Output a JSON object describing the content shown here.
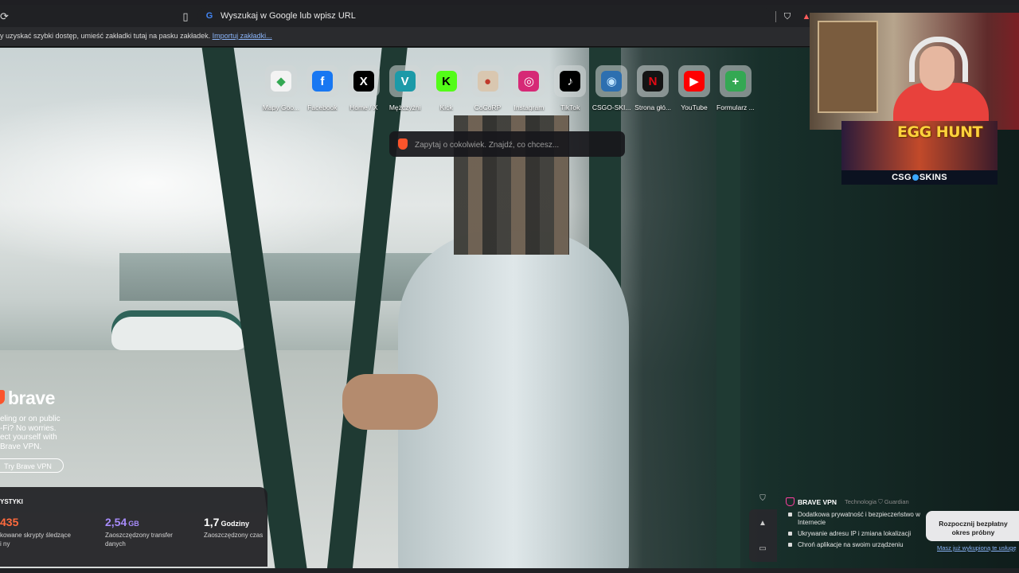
{
  "toolbar": {
    "url_placeholder": "Wyszukaj w Google lub wpisz URL"
  },
  "bookmarks_bar": {
    "message": "y uzyskać szybki dostęp, umieść zakładki tutaj na pasku zakładek.",
    "import_link": "Importuj zakładki..."
  },
  "shortcuts": [
    {
      "label": "Mapy Goo...",
      "icon": "maps-icon",
      "glyph": "◆",
      "bg": "#f3f3f3",
      "color": "#34a853"
    },
    {
      "label": "Facebook",
      "icon": "facebook-icon",
      "glyph": "f",
      "bg": "#1877f2",
      "color": "#ffffff"
    },
    {
      "label": "Home / X",
      "icon": "x-icon",
      "glyph": "X",
      "bg": "#000000",
      "color": "#ffffff"
    },
    {
      "label": "Mężczyźni",
      "icon": "v-icon",
      "glyph": "V",
      "bg": "#1c9aa8",
      "color": "#ffffff"
    },
    {
      "label": "Kick",
      "icon": "kick-icon",
      "glyph": "K",
      "bg": "#53fc18",
      "color": "#000000"
    },
    {
      "label": "CoCoRP",
      "icon": "cocorp-icon",
      "glyph": "●",
      "bg": "#d9c7b0",
      "color": "#c0392b"
    },
    {
      "label": "Instagram",
      "icon": "instagram-icon",
      "glyph": "◎",
      "bg": "#d62976",
      "color": "#ffffff"
    },
    {
      "label": "TikTok",
      "icon": "tiktok-icon",
      "glyph": "♪",
      "bg": "#000000",
      "color": "#ffffff"
    },
    {
      "label": "CSGO-SKI...",
      "icon": "csgoskins-icon",
      "glyph": "◉",
      "bg": "#2d6fb0",
      "color": "#bfe4ff"
    },
    {
      "label": "Strona głó...",
      "icon": "netflix-icon",
      "glyph": "N",
      "bg": "#141414",
      "color": "#e50914"
    },
    {
      "label": "YouTube",
      "icon": "youtube-icon",
      "glyph": "▶",
      "bg": "#ff0000",
      "color": "#ffffff"
    },
    {
      "label": "Formularz ...",
      "icon": "plus-icon",
      "glyph": "+",
      "bg": "#34a853",
      "color": "#ffffff"
    }
  ],
  "search": {
    "placeholder": "Zapytaj o cokolwiek. Znajdź, co chcesz..."
  },
  "promo": {
    "logo_text": "brave",
    "lines": [
      "eling or on public",
      "-Fi? No worries.",
      "ect yourself with",
      "Brave VPN."
    ],
    "button": "Try Brave VPN"
  },
  "stats": {
    "title": "YSTYKI",
    "items": [
      {
        "value": "435",
        "unit": "",
        "caption": "kowane skrypty śledzące i ny",
        "color": "#ff6a3d"
      },
      {
        "value": "2,54",
        "unit": "GB",
        "caption": "Zaoszczędzony transfer danych",
        "color": "#a78bfa"
      },
      {
        "value": "1,7",
        "unit": "Godziny",
        "caption": "Zaoszczędzony czas",
        "color": "#ffffff"
      }
    ]
  },
  "vpn": {
    "title": "BRAVE VPN",
    "tech": "Technologia ⛉ Guardian",
    "features": [
      "Dodatkowa prywatność i bezpieczeństwo w Internecie",
      "Ukrywanie adresu IP i zmiana lokalizacji",
      "Chroń aplikacje na swoim urządzeniu"
    ],
    "cta": "Rozpocznij bezpłatny okres próbny",
    "already": "Masz już wykupioną te usługę"
  },
  "overlay": {
    "event_title": "EGG HUNT",
    "brand_left": "CSG",
    "brand_right": "SKINS"
  }
}
